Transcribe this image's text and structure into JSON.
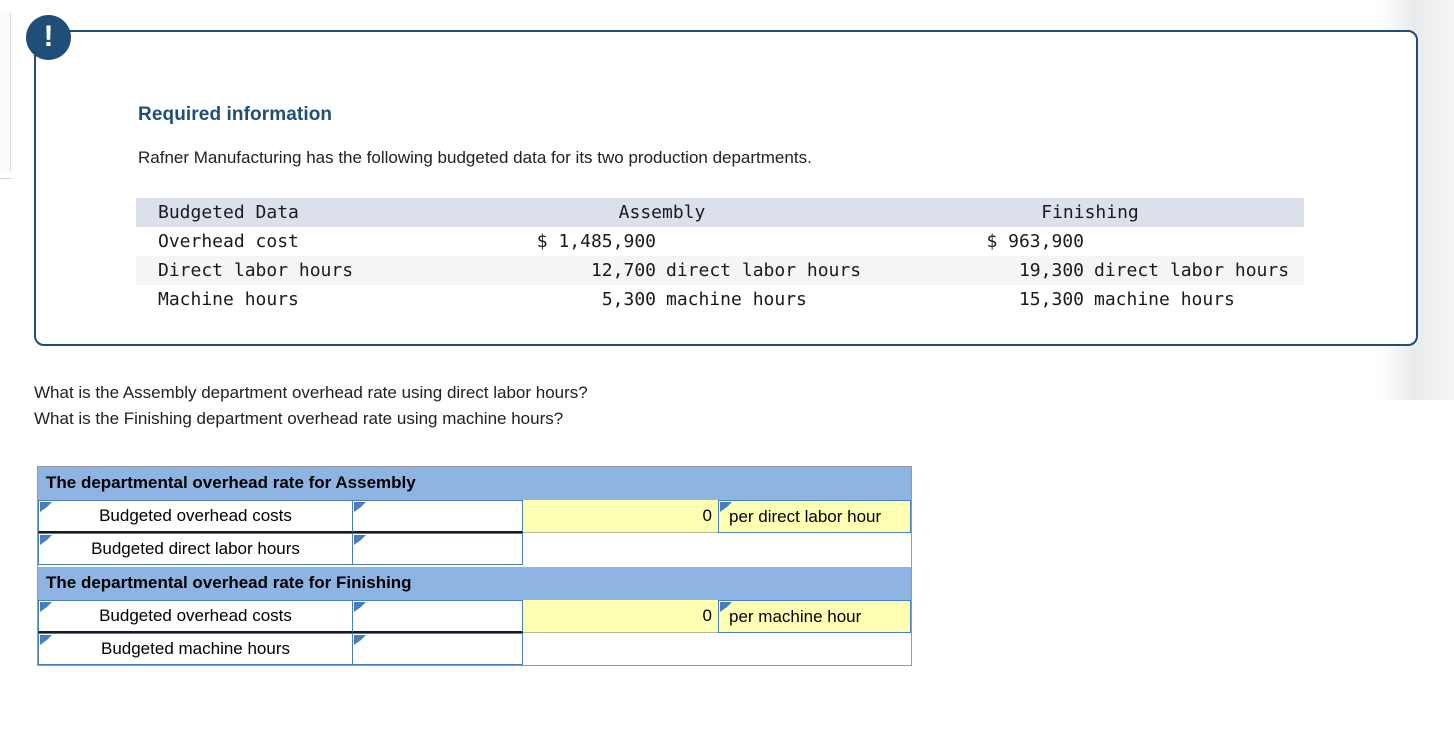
{
  "panel": {
    "badge_icon": "exclamation-icon",
    "title": "Required information",
    "intro": "Rafner Manufacturing has the following budgeted data for its two production departments."
  },
  "data_table": {
    "headers": {
      "label": "Budgeted Data",
      "assembly": "Assembly",
      "finishing": "Finishing"
    },
    "rows": [
      {
        "label": "Overhead cost",
        "assembly_value": "$ 1,485,900",
        "assembly_unit": "",
        "finishing_value": "$ 963,900",
        "finishing_unit": ""
      },
      {
        "label": "Direct labor hours",
        "assembly_value": "12,700",
        "assembly_unit": "direct labor hours",
        "finishing_value": "19,300",
        "finishing_unit": "direct labor hours"
      },
      {
        "label": "Machine hours",
        "assembly_value": "5,300",
        "assembly_unit": "machine hours",
        "finishing_value": "15,300",
        "finishing_unit": "machine hours"
      }
    ]
  },
  "questions": {
    "line1": "What is the Assembly department overhead rate using direct labor hours?",
    "line2": "What is the Finishing department overhead rate using machine hours?"
  },
  "answer_table": {
    "assembly": {
      "section_title": "The departmental overhead rate for Assembly",
      "numerator_label": "Budgeted overhead costs",
      "numerator_input": "",
      "result_value": "0",
      "result_unit": "per direct labor hour",
      "denominator_label": "Budgeted direct labor hours",
      "denominator_input": ""
    },
    "finishing": {
      "section_title": "The departmental overhead rate for Finishing",
      "numerator_label": "Budgeted overhead costs",
      "numerator_input": "",
      "result_value": "0",
      "result_unit": "per machine hour",
      "denominator_label": "Budgeted machine hours",
      "denominator_input": ""
    }
  },
  "colors": {
    "panel_border": "#1F4E79",
    "badge": "#1F4E79",
    "title": "#1F4E79",
    "table_header_bg": "#dbe0eb",
    "table_alt_row_bg": "#f5f5f5",
    "section_header_bg": "#8DB4E2",
    "cell_border": "#4A7EBB",
    "result_bg": "#FFFFB3"
  }
}
